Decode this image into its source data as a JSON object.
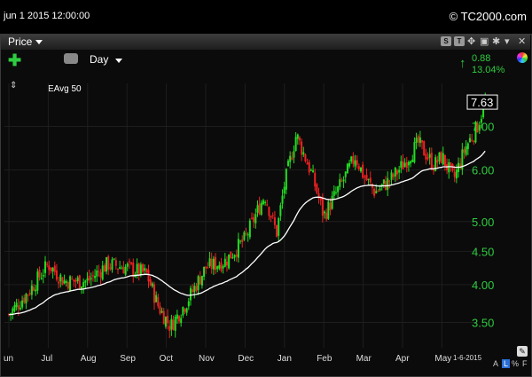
{
  "header": {
    "date": "jun 1 2015 12:00:00",
    "brand": "© TC2000.com"
  },
  "panel": {
    "price_label": "Price",
    "period": "Day",
    "change_value": "0.88",
    "change_pct": "13.04%",
    "indicator": "EAvg 50",
    "last_price": "7.63",
    "date_tag": "1-6-2015"
  },
  "bottom_controls": [
    "A",
    "L",
    "%",
    "F"
  ],
  "colors": {
    "up": "#22dd22",
    "down": "#ee2222",
    "avg": "#ffffff",
    "axis_text": "#2ecc40"
  },
  "chart_data": {
    "type": "candlestick",
    "x_ticks": [
      "un",
      "Jul",
      "Aug",
      "Sep",
      "Oct",
      "Nov",
      "Dec",
      "Jan",
      "Feb",
      "Mar",
      "Apr",
      "May"
    ],
    "y_ticks": [
      "7.00",
      "6.00",
      "5.00",
      "4.50",
      "4.00",
      "3.50"
    ],
    "y_scale": "log",
    "ylim": [
      3.2,
      7.9
    ],
    "close_anchors": [
      {
        "m": 0,
        "v": 3.6
      },
      {
        "m": 0.5,
        "v": 3.9
      },
      {
        "m": 1,
        "v": 4.3
      },
      {
        "m": 1.4,
        "v": 4.05
      },
      {
        "m": 2,
        "v": 4.05
      },
      {
        "m": 2.5,
        "v": 4.3
      },
      {
        "m": 3,
        "v": 4.25
      },
      {
        "m": 3.5,
        "v": 4.15
      },
      {
        "m": 3.8,
        "v": 3.7
      },
      {
        "m": 4.1,
        "v": 3.45
      },
      {
        "m": 4.5,
        "v": 3.75
      },
      {
        "m": 5,
        "v": 4.25
      },
      {
        "m": 5.5,
        "v": 4.35
      },
      {
        "m": 6,
        "v": 4.7
      },
      {
        "m": 6.5,
        "v": 5.5
      },
      {
        "m": 6.8,
        "v": 4.8
      },
      {
        "m": 7,
        "v": 5.7
      },
      {
        "m": 7.3,
        "v": 6.8
      },
      {
        "m": 7.7,
        "v": 5.9
      },
      {
        "m": 8,
        "v": 5.1
      },
      {
        "m": 8.5,
        "v": 5.8
      },
      {
        "m": 8.8,
        "v": 6.3
      },
      {
        "m": 9,
        "v": 5.9
      },
      {
        "m": 9.3,
        "v": 5.55
      },
      {
        "m": 9.7,
        "v": 5.8
      },
      {
        "m": 10,
        "v": 6.1
      },
      {
        "m": 10.4,
        "v": 6.6
      },
      {
        "m": 10.8,
        "v": 6.1
      },
      {
        "m": 11,
        "v": 6.3
      },
      {
        "m": 11.3,
        "v": 5.8
      },
      {
        "m": 11.6,
        "v": 6.5
      },
      {
        "m": 11.9,
        "v": 7.0
      },
      {
        "m": 12.1,
        "v": 7.63
      }
    ]
  }
}
